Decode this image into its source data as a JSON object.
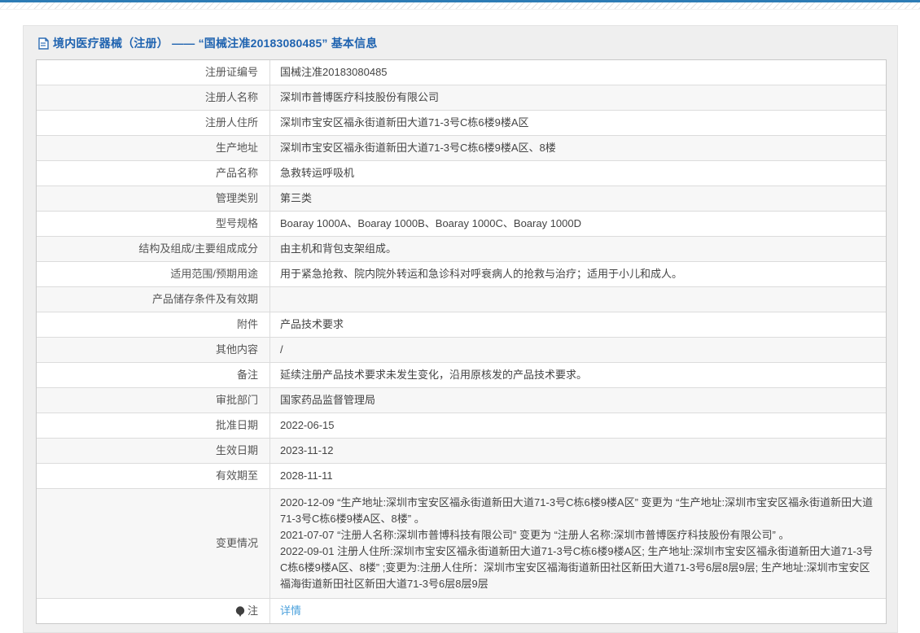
{
  "page": {
    "title": "境内医疗器械（注册） —— “国械注准20183080485” 基本信息"
  },
  "colors": {
    "accent_blue": "#1f63b0",
    "link_blue": "#4aa0dc",
    "top_line": "#2d7cb5",
    "panel_bg": "#efefef",
    "row_alt_bg": "#f7f7f7",
    "border": "#c9c9c9"
  },
  "icons": {
    "title_icon": "document-icon",
    "note_icon": "bulb-icon"
  },
  "table": {
    "rows": [
      {
        "label": "注册证编号",
        "value": "国械注准20183080485"
      },
      {
        "label": "注册人名称",
        "value": "深圳市普博医疗科技股份有限公司"
      },
      {
        "label": "注册人住所",
        "value": "深圳市宝安区福永街道新田大道71-3号C栋6楼9楼A区"
      },
      {
        "label": "生产地址",
        "value": "深圳市宝安区福永街道新田大道71-3号C栋6楼9楼A区、8楼"
      },
      {
        "label": "产品名称",
        "value": "急救转运呼吸机"
      },
      {
        "label": "管理类别",
        "value": "第三类"
      },
      {
        "label": "型号规格",
        "value": "Boaray 1000A、Boaray 1000B、Boaray 1000C、Boaray 1000D"
      },
      {
        "label": "结构及组成/主要组成成分",
        "value": "由主机和背包支架组成。"
      },
      {
        "label": "适用范围/预期用途",
        "value": "用于紧急抢救、院内院外转运和急诊科对呼衰病人的抢救与治疗；适用于小儿和成人。"
      },
      {
        "label": "产品储存条件及有效期",
        "value": ""
      },
      {
        "label": "附件",
        "value": "产品技术要求"
      },
      {
        "label": "其他内容",
        "value": "/"
      },
      {
        "label": "备注",
        "value": "延续注册产品技术要求未发生变化，沿用原核发的产品技术要求。"
      },
      {
        "label": "审批部门",
        "value": "国家药品监督管理局"
      },
      {
        "label": "批准日期",
        "value": "2022-06-15"
      },
      {
        "label": "生效日期",
        "value": "2023-11-12"
      },
      {
        "label": "有效期至",
        "value": "2028-11-11"
      },
      {
        "label": "变更情况",
        "lines": [
          "2020-12-09 “生产地址:深圳市宝安区福永街道新田大道71-3号C栋6楼9楼A区” 变更为 “生产地址:深圳市宝安区福永街道新田大道71-3号C栋6楼9楼A区、8楼” 。",
          "2021-07-07 “注册人名称:深圳市普博科技有限公司” 变更为 “注册人名称:深圳市普博医疗科技股份有限公司” 。",
          "2022-09-01 注册人住所:深圳市宝安区福永街道新田大道71-3号C栋6楼9楼A区; 生产地址:深圳市宝安区福永街道新田大道71-3号C栋6楼9楼A区、8楼” ;变更为:注册人住所：深圳市宝安区福海街道新田社区新田大道71-3号6层8层9层; 生产地址:深圳市宝安区福海街道新田社区新田大道71-3号6层8层9层"
        ]
      },
      {
        "label": "注",
        "value": "详情"
      }
    ]
  }
}
